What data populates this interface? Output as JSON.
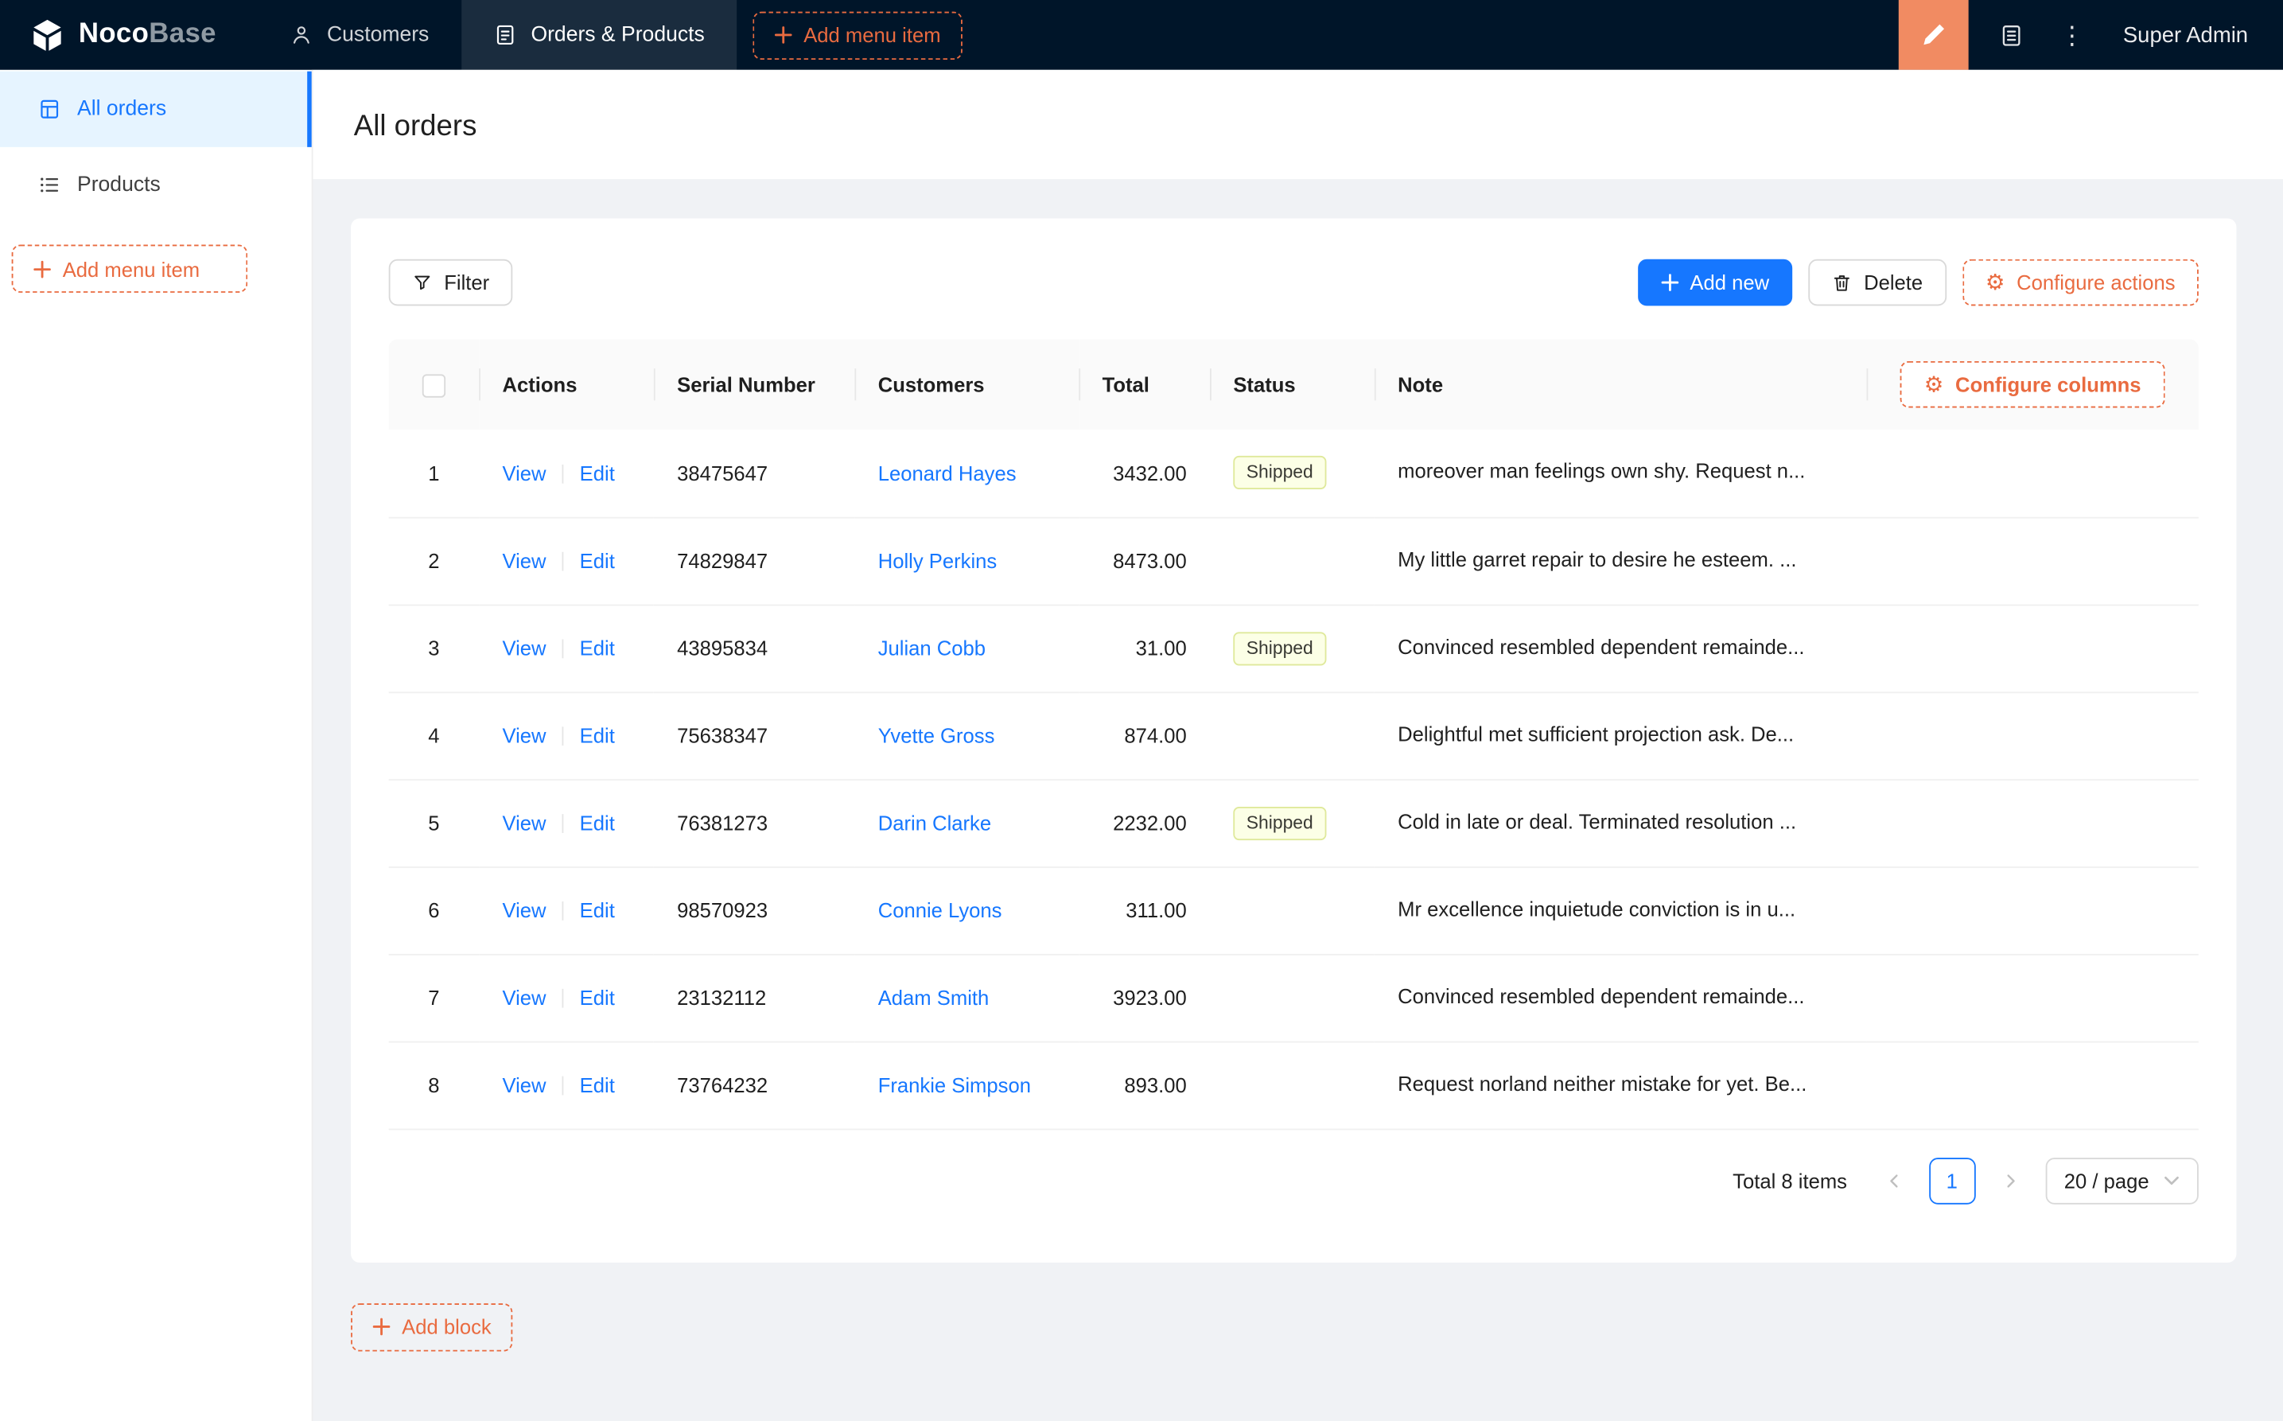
{
  "colors": {
    "accent_orange": "#E96B40",
    "designer_button_bg": "#F18B62",
    "primary_blue": "#1677FF",
    "header_bg": "#001529",
    "sidebar_active_bg": "#E6F4FF",
    "badge_bg": "#FCFFE6"
  },
  "icons": {
    "gear": "⚙",
    "ellipsis": "⋮"
  },
  "header": {
    "logo_bold": "Noco",
    "logo_light": "Base",
    "nav": [
      {
        "label": "Customers",
        "active": false
      },
      {
        "label": "Orders & Products",
        "active": true
      }
    ],
    "add_menu_item": "Add menu item",
    "user": "Super Admin"
  },
  "sidebar": {
    "items": [
      {
        "label": "All orders",
        "active": true
      },
      {
        "label": "Products",
        "active": false
      }
    ],
    "add_menu_item": "Add menu item"
  },
  "page": {
    "title": "All orders"
  },
  "toolbar": {
    "filter": "Filter",
    "add_new": "Add new",
    "delete": "Delete",
    "configure_actions": "Configure actions"
  },
  "table": {
    "configure_columns": "Configure columns",
    "columns": [
      "Actions",
      "Serial Number",
      "Customers",
      "Total",
      "Status",
      "Note"
    ],
    "action_view": "View",
    "action_edit": "Edit",
    "rows": [
      {
        "index": "1",
        "serial": "38475647",
        "customer": "Leonard Hayes",
        "total": "3432.00",
        "status": "Shipped",
        "note": "moreover man feelings own shy. Request n..."
      },
      {
        "index": "2",
        "serial": "74829847",
        "customer": "Holly Perkins",
        "total": "8473.00",
        "status": "",
        "note": "My little garret repair to desire he esteem. ..."
      },
      {
        "index": "3",
        "serial": "43895834",
        "customer": "Julian Cobb",
        "total": "31.00",
        "status": "Shipped",
        "note": "Convinced resembled dependent remainde..."
      },
      {
        "index": "4",
        "serial": "75638347",
        "customer": "Yvette Gross",
        "total": "874.00",
        "status": "",
        "note": "Delightful met sufficient projection ask. De..."
      },
      {
        "index": "5",
        "serial": "76381273",
        "customer": "Darin Clarke",
        "total": "2232.00",
        "status": "Shipped",
        "note": "Cold in late or deal. Terminated resolution ..."
      },
      {
        "index": "6",
        "serial": "98570923",
        "customer": "Connie Lyons",
        "total": "311.00",
        "status": "",
        "note": "Mr excellence inquietude conviction is in u..."
      },
      {
        "index": "7",
        "serial": "23132112",
        "customer": "Adam Smith",
        "total": "3923.00",
        "status": "",
        "note": "Convinced resembled dependent remainde..."
      },
      {
        "index": "8",
        "serial": "73764232",
        "customer": "Frankie Simpson",
        "total": "893.00",
        "status": "",
        "note": "Request norland neither mistake for yet. Be..."
      }
    ]
  },
  "pagination": {
    "total": "Total 8 items",
    "page": "1",
    "page_size": "20 / page"
  },
  "footer": {
    "add_block": "Add block"
  }
}
